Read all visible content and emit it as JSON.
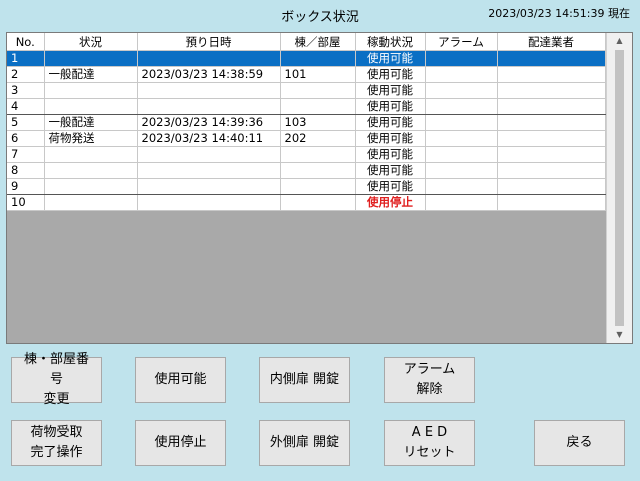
{
  "header": {
    "title": "ボックス状況",
    "datetime": "2023/03/23 14:51:39 現在"
  },
  "grid": {
    "columns": [
      "No.",
      "状況",
      "預り日時",
      "棟／部屋",
      "稼動状況",
      "アラーム",
      "配達業者"
    ],
    "rows": [
      {
        "no": "1",
        "status": "",
        "datetime": "",
        "room": "",
        "operation": "使用可能",
        "alarm": "",
        "carrier": ""
      },
      {
        "no": "2",
        "status": "一般配達",
        "datetime": "2023/03/23 14:38:59",
        "room": "101",
        "operation": "使用可能",
        "alarm": "",
        "carrier": ""
      },
      {
        "no": "3",
        "status": "",
        "datetime": "",
        "room": "",
        "operation": "使用可能",
        "alarm": "",
        "carrier": ""
      },
      {
        "no": "4",
        "status": "",
        "datetime": "",
        "room": "",
        "operation": "使用可能",
        "alarm": "",
        "carrier": ""
      },
      {
        "no": "5",
        "status": "一般配達",
        "datetime": "2023/03/23 14:39:36",
        "room": "103",
        "operation": "使用可能",
        "alarm": "",
        "carrier": ""
      },
      {
        "no": "6",
        "status": "荷物発送",
        "datetime": "2023/03/23 14:40:11",
        "room": "202",
        "operation": "使用可能",
        "alarm": "",
        "carrier": ""
      },
      {
        "no": "7",
        "status": "",
        "datetime": "",
        "room": "",
        "operation": "使用可能",
        "alarm": "",
        "carrier": ""
      },
      {
        "no": "8",
        "status": "",
        "datetime": "",
        "room": "",
        "operation": "使用可能",
        "alarm": "",
        "carrier": ""
      },
      {
        "no": "9",
        "status": "",
        "datetime": "",
        "room": "",
        "operation": "使用可能",
        "alarm": "",
        "carrier": ""
      },
      {
        "no": "10",
        "status": "",
        "datetime": "",
        "room": "",
        "operation": "使用停止",
        "alarm": "",
        "carrier": ""
      }
    ],
    "selected_row": "1",
    "stopped_color": "#e02020",
    "selection_color": "#0a6fc4"
  },
  "scrollbar": {
    "up_icon": "▲",
    "down_icon": "▼"
  },
  "buttons": {
    "room_change": "棟・部屋番号\n変更",
    "set_available": "使用可能",
    "inner_door": "内側扉 開錠",
    "alarm_clear": "アラーム\n解除",
    "complete_pickup": "荷物受取\n完了操作",
    "set_stopped": "使用停止",
    "outer_door": "外側扉 開錠",
    "aed_reset": "A E D\nリセット",
    "back": "戻る"
  }
}
